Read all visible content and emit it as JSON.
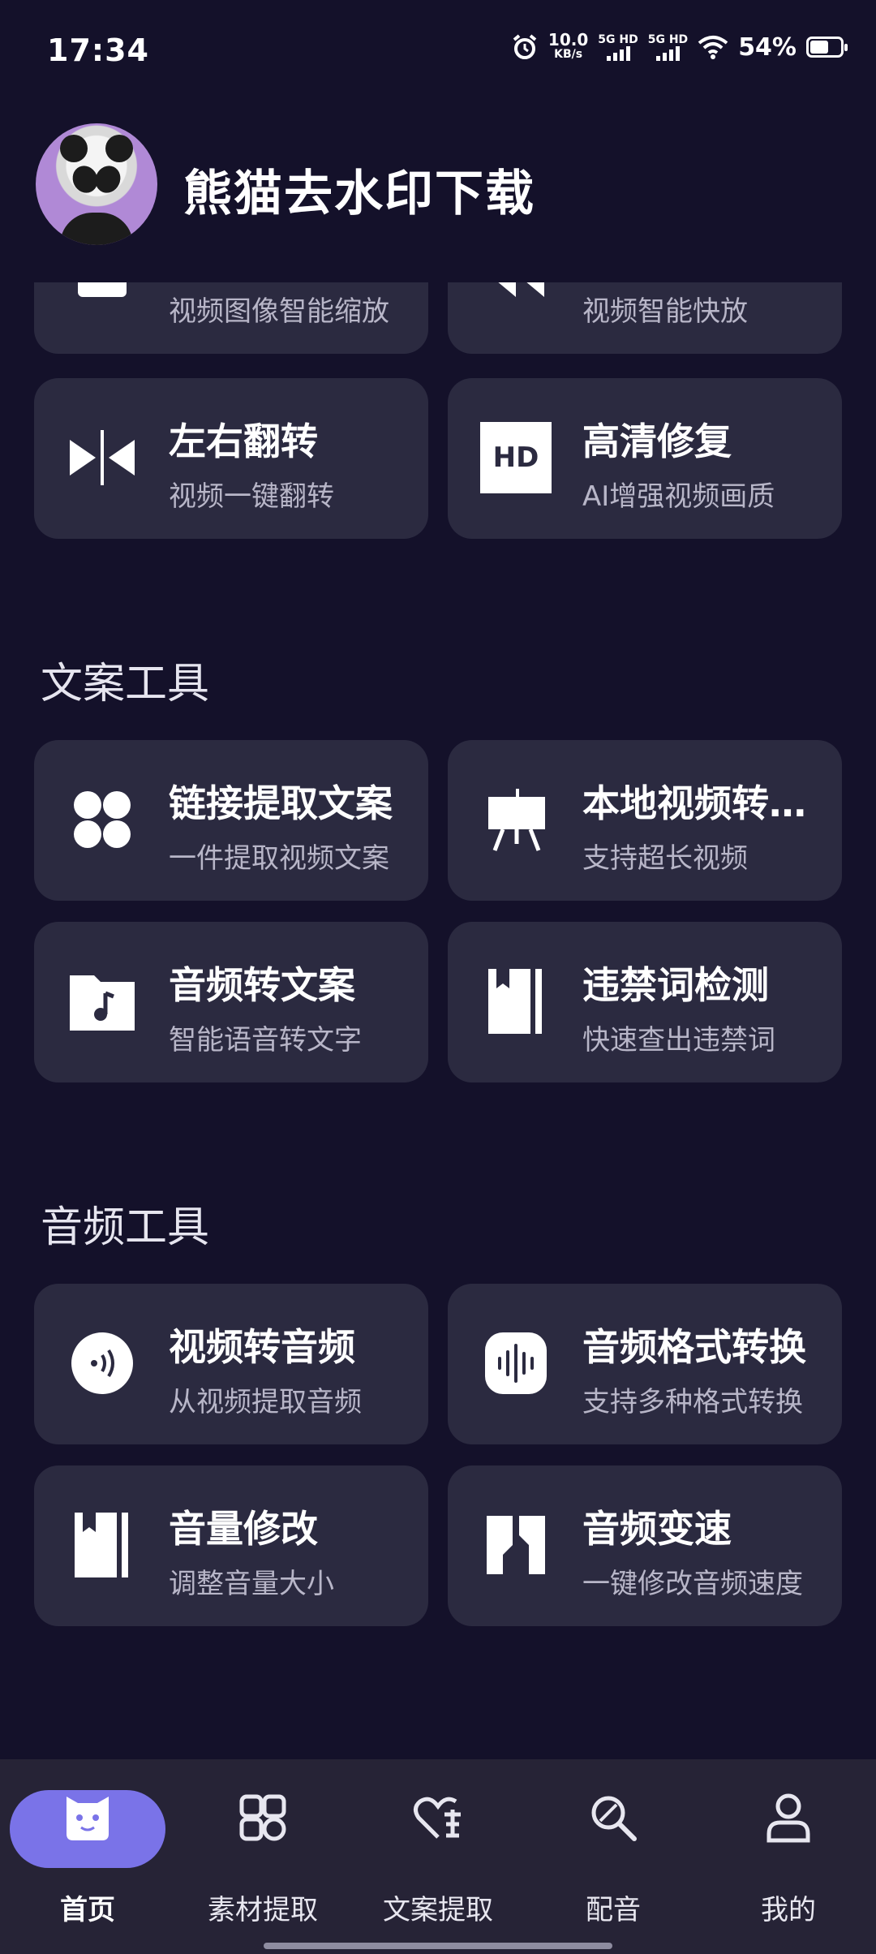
{
  "status_bar": {
    "time": "17:34",
    "net_speed_value": "10.0",
    "net_speed_unit": "KB/s",
    "sim1": "5G HD",
    "sim2": "5G HD",
    "battery": "54%"
  },
  "header": {
    "title": "熊猫去水印下载"
  },
  "video_tools_partial": [
    {
      "title": "",
      "sub": "视频图像智能缩放",
      "icon": "ai-scale-icon"
    },
    {
      "title": "",
      "sub": "视频智能快放",
      "icon": "fast-forward-icon"
    },
    {
      "title": "左右翻转",
      "sub": "视频一键翻转",
      "icon": "flip-horizontal-icon"
    },
    {
      "title": "高清修复",
      "sub": "AI增强视频画质",
      "icon": "hd-icon",
      "icon_text": "HD"
    }
  ],
  "copy_tools": {
    "title": "文案工具",
    "items": [
      {
        "title": "链接提取文案",
        "sub": "一件提取视频文案",
        "icon": "clover-icon"
      },
      {
        "title": "本地视频转…",
        "sub": "支持超长视频",
        "icon": "easel-icon"
      },
      {
        "title": "音频转文案",
        "sub": "智能语音转文字",
        "icon": "music-folder-icon"
      },
      {
        "title": "违禁词检测",
        "sub": "快速查出违禁词",
        "icon": "book-icon"
      }
    ]
  },
  "audio_tools": {
    "title": "音频工具",
    "items": [
      {
        "title": "视频转音频",
        "sub": "从视频提取音频",
        "icon": "audio-circle-icon"
      },
      {
        "title": "音频格式转换",
        "sub": "支持多种格式转换",
        "icon": "waveform-icon"
      },
      {
        "title": "音量修改",
        "sub": "调整音量大小",
        "icon": "book-icon"
      },
      {
        "title": "音频变速",
        "sub": "一键修改音频速度",
        "icon": "split-speed-icon"
      }
    ]
  },
  "bottom_nav": [
    {
      "label": "首页",
      "icon": "home-bear-icon",
      "active": true
    },
    {
      "label": "素材提取",
      "icon": "material-icon",
      "active": false
    },
    {
      "label": "文案提取",
      "icon": "heart-text-icon",
      "active": false
    },
    {
      "label": "配音",
      "icon": "magnifier-icon",
      "active": false
    },
    {
      "label": "我的",
      "icon": "user-icon",
      "active": false
    }
  ],
  "colors": {
    "background": "#14112a",
    "card": "#2b2a40",
    "nav_active": "#7a73e8",
    "nav_bar": "#262336"
  }
}
